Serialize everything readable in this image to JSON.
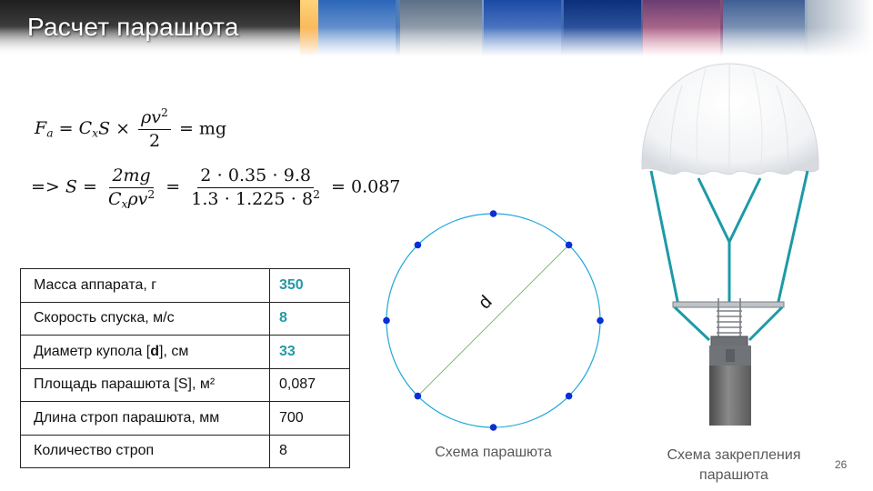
{
  "header": {
    "title": "Расчет парашюта"
  },
  "formula": {
    "line1": {
      "lhs_var": "F",
      "lhs_sub": "a",
      "cx": "C",
      "cx_sub": "x",
      "s": "S",
      "times": "×",
      "num_rho": "ρ",
      "num_v": "v",
      "num_exp": "2",
      "den": "2",
      "eq": "=",
      "rhs": "mg"
    },
    "line2": {
      "prefix": "=>",
      "s": "S",
      "eq1": "=",
      "f1_num": "2mg",
      "f1_den_c": "C",
      "f1_den_sub": "x",
      "f1_den_rest": "ρv",
      "f1_den_exp": "2",
      "eq2": "=",
      "f2_num": "2 ⋅ 0.35 ⋅ 9.8",
      "f2_den": "1.3 ⋅ 1.225 ⋅ 8",
      "f2_den_exp": "2",
      "eq3": "=",
      "result": "0.087"
    }
  },
  "table": {
    "rows": [
      {
        "label": "Масса аппарата,  г",
        "value": "350",
        "highlight": true
      },
      {
        "label": "Скорость спуска, м/с",
        "value": "8",
        "highlight": true
      },
      {
        "label_pre": "Диаметр купола [",
        "label_bold": "d",
        "label_post": "], см",
        "value": "33",
        "highlight": true
      },
      {
        "label": "Площадь парашюта  [S], м²",
        "value": "0,087",
        "highlight": false
      },
      {
        "label": "Длина  строп парашюта,  мм",
        "value": "700",
        "highlight": false
      },
      {
        "label": "Количество строп",
        "value": "8",
        "highlight": false
      }
    ]
  },
  "diagram": {
    "diameter_label": "d",
    "caption": "Схема парашюта",
    "circle_color": "#1fa8d8",
    "line_color": "#77c36a",
    "point_color": "#0a2fd6",
    "points_count": 8
  },
  "mount": {
    "caption_line1": "Схема закрепления",
    "caption_line2": "парашюта",
    "line_color": "#1c9aa6"
  },
  "page_number": "26"
}
